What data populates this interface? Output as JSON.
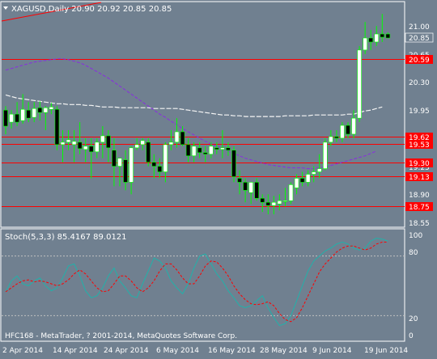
{
  "title": {
    "symbol_line": "XAGUSD,Daily  20.90 20.92 20.85 20.85"
  },
  "price_axis": {
    "ticks": [
      "21.00",
      "20.65",
      "20.30",
      "19.95",
      "19.25",
      "18.90",
      "18.55"
    ],
    "ylim": [
      18.45,
      21.2
    ]
  },
  "current_price": "20.85",
  "horizontal_levels": [
    {
      "label": "20.59",
      "value": 20.59
    },
    {
      "label": "19.62",
      "value": 19.62
    },
    {
      "label": "19.53",
      "value": 19.53
    },
    {
      "label": "19.30",
      "value": 19.3
    },
    {
      "label": "19.13",
      "value": 19.13
    },
    {
      "label": "18.75",
      "value": 18.75
    }
  ],
  "stoch": {
    "label": "Stoch(5,3,3) 85.4167 89.0121",
    "ticks": [
      "100",
      "80",
      "20",
      "0"
    ],
    "levels": [
      80,
      20
    ]
  },
  "date_axis": {
    "labels": [
      "2 Apr 2014",
      "14 Apr 2014",
      "24 Apr 2014",
      "6 May 2014",
      "16 May 2014",
      "28 May 2014",
      "9 Jun 2014",
      "19 Jun 2014"
    ]
  },
  "copyright": "HFC168 - MetaTrader, ? 2001-2014, MetaQuotes Software Corp.",
  "colors": {
    "background": "#708090",
    "bull_candle": "#ffffff",
    "bear_candle": "#000000",
    "wick": "#00ff00",
    "level_line": "#ff0000",
    "ma_slow": "#f5f5f5",
    "ma_fast": "#8a2be2",
    "stoch_main": "#20b2aa",
    "stoch_signal": "#ff0000"
  },
  "chart_data": {
    "type": "candlestick",
    "title": "XAGUSD,Daily",
    "candles": [
      {
        "o": 19.95,
        "h": 20.0,
        "l": 19.65,
        "c": 19.75
      },
      {
        "o": 19.8,
        "h": 19.95,
        "l": 19.72,
        "c": 19.9
      },
      {
        "o": 19.9,
        "h": 20.05,
        "l": 19.75,
        "c": 19.8
      },
      {
        "o": 19.82,
        "h": 20.15,
        "l": 19.78,
        "c": 19.96
      },
      {
        "o": 19.95,
        "h": 20.05,
        "l": 19.8,
        "c": 19.85
      },
      {
        "o": 19.86,
        "h": 20.05,
        "l": 19.8,
        "c": 19.97
      },
      {
        "o": 19.98,
        "h": 20.06,
        "l": 19.82,
        "c": 19.92
      },
      {
        "o": 19.92,
        "h": 20.0,
        "l": 19.7,
        "c": 19.98
      },
      {
        "o": 19.96,
        "h": 20.04,
        "l": 19.9,
        "c": 19.99
      },
      {
        "o": 19.96,
        "h": 20.0,
        "l": 19.45,
        "c": 19.52
      },
      {
        "o": 19.52,
        "h": 19.7,
        "l": 19.3,
        "c": 19.55
      },
      {
        "o": 19.55,
        "h": 19.7,
        "l": 19.45,
        "c": 19.58
      },
      {
        "o": 19.52,
        "h": 19.7,
        "l": 19.3,
        "c": 19.56
      },
      {
        "o": 19.55,
        "h": 19.8,
        "l": 19.4,
        "c": 19.47
      },
      {
        "o": 19.46,
        "h": 19.6,
        "l": 19.3,
        "c": 19.5
      },
      {
        "o": 19.5,
        "h": 19.6,
        "l": 19.1,
        "c": 19.43
      },
      {
        "o": 19.43,
        "h": 19.6,
        "l": 19.35,
        "c": 19.55
      },
      {
        "o": 19.55,
        "h": 19.75,
        "l": 19.35,
        "c": 19.63
      },
      {
        "o": 19.63,
        "h": 19.7,
        "l": 19.3,
        "c": 19.48
      },
      {
        "o": 19.45,
        "h": 19.6,
        "l": 19.0,
        "c": 19.25
      },
      {
        "o": 19.25,
        "h": 19.35,
        "l": 19.0,
        "c": 19.35
      },
      {
        "o": 19.33,
        "h": 19.45,
        "l": 18.95,
        "c": 19.05
      },
      {
        "o": 19.05,
        "h": 19.5,
        "l": 18.9,
        "c": 19.48
      },
      {
        "o": 19.48,
        "h": 19.6,
        "l": 19.45,
        "c": 19.52
      },
      {
        "o": 19.52,
        "h": 19.6,
        "l": 19.45,
        "c": 19.57
      },
      {
        "o": 19.55,
        "h": 19.6,
        "l": 19.25,
        "c": 19.3
      },
      {
        "o": 19.3,
        "h": 19.4,
        "l": 19.1,
        "c": 19.25
      },
      {
        "o": 19.25,
        "h": 19.35,
        "l": 19.1,
        "c": 19.18
      },
      {
        "o": 19.18,
        "h": 19.55,
        "l": 19.05,
        "c": 19.52
      },
      {
        "o": 19.52,
        "h": 19.7,
        "l": 19.45,
        "c": 19.55
      },
      {
        "o": 19.55,
        "h": 19.85,
        "l": 19.48,
        "c": 19.68
      },
      {
        "o": 19.68,
        "h": 19.75,
        "l": 19.5,
        "c": 19.52
      },
      {
        "o": 19.52,
        "h": 19.6,
        "l": 19.3,
        "c": 19.38
      },
      {
        "o": 19.38,
        "h": 19.55,
        "l": 19.3,
        "c": 19.5
      },
      {
        "o": 19.48,
        "h": 19.55,
        "l": 19.35,
        "c": 19.42
      },
      {
        "o": 19.42,
        "h": 19.5,
        "l": 19.3,
        "c": 19.4
      },
      {
        "o": 19.4,
        "h": 19.55,
        "l": 19.35,
        "c": 19.5
      },
      {
        "o": 19.48,
        "h": 19.55,
        "l": 19.4,
        "c": 19.46
      },
      {
        "o": 19.46,
        "h": 19.7,
        "l": 19.35,
        "c": 19.48
      },
      {
        "o": 19.48,
        "h": 19.55,
        "l": 19.38,
        "c": 19.45
      },
      {
        "o": 19.45,
        "h": 19.5,
        "l": 19.05,
        "c": 19.12
      },
      {
        "o": 19.1,
        "h": 19.2,
        "l": 18.9,
        "c": 19.05
      },
      {
        "o": 19.05,
        "h": 19.1,
        "l": 18.8,
        "c": 18.95
      },
      {
        "o": 18.92,
        "h": 19.05,
        "l": 18.78,
        "c": 19.05
      },
      {
        "o": 19.05,
        "h": 19.1,
        "l": 18.82,
        "c": 18.85
      },
      {
        "o": 18.85,
        "h": 18.9,
        "l": 18.68,
        "c": 18.8
      },
      {
        "o": 18.8,
        "h": 18.9,
        "l": 18.65,
        "c": 18.76
      },
      {
        "o": 18.76,
        "h": 18.88,
        "l": 18.65,
        "c": 18.8
      },
      {
        "o": 18.78,
        "h": 18.9,
        "l": 18.7,
        "c": 18.82
      },
      {
        "o": 18.82,
        "h": 18.98,
        "l": 18.75,
        "c": 18.82
      },
      {
        "o": 18.82,
        "h": 19.05,
        "l": 18.78,
        "c": 19.02
      },
      {
        "o": 18.98,
        "h": 19.15,
        "l": 18.9,
        "c": 19.1
      },
      {
        "o": 19.1,
        "h": 19.18,
        "l": 19.0,
        "c": 19.05
      },
      {
        "o": 19.05,
        "h": 19.2,
        "l": 19.0,
        "c": 19.15
      },
      {
        "o": 19.15,
        "h": 19.25,
        "l": 19.05,
        "c": 19.18
      },
      {
        "o": 19.18,
        "h": 19.4,
        "l": 19.1,
        "c": 19.22
      },
      {
        "o": 19.22,
        "h": 19.6,
        "l": 19.2,
        "c": 19.55
      },
      {
        "o": 19.55,
        "h": 19.7,
        "l": 19.5,
        "c": 19.62
      },
      {
        "o": 19.62,
        "h": 19.7,
        "l": 19.55,
        "c": 19.6
      },
      {
        "o": 19.6,
        "h": 19.8,
        "l": 19.55,
        "c": 19.76
      },
      {
        "o": 19.76,
        "h": 19.8,
        "l": 19.6,
        "c": 19.65
      },
      {
        "o": 19.65,
        "h": 19.95,
        "l": 19.6,
        "c": 19.85
      },
      {
        "o": 19.85,
        "h": 20.75,
        "l": 19.8,
        "c": 20.7
      },
      {
        "o": 20.7,
        "h": 21.05,
        "l": 20.65,
        "c": 20.85
      },
      {
        "o": 20.85,
        "h": 20.95,
        "l": 20.7,
        "c": 20.8
      },
      {
        "o": 20.8,
        "h": 21.0,
        "l": 20.75,
        "c": 20.9
      },
      {
        "o": 20.9,
        "h": 21.15,
        "l": 20.8,
        "c": 20.86
      },
      {
        "o": 20.9,
        "h": 20.92,
        "l": 20.85,
        "c": 20.85
      }
    ],
    "ma_slow": [
      20.14,
      20.12,
      20.1,
      20.09,
      20.08,
      20.07,
      20.06,
      20.05,
      20.04,
      20.03,
      20.03,
      20.02,
      20.02,
      20.02,
      20.01,
      20.01,
      20.0,
      19.99,
      19.99,
      19.99,
      19.98,
      19.98,
      19.98,
      19.98,
      19.98,
      19.98,
      19.97,
      19.97,
      19.97,
      19.97,
      19.97,
      19.96,
      19.95,
      19.94,
      19.93,
      19.92,
      19.91,
      19.9,
      19.89,
      19.89,
      19.88,
      19.88,
      19.87,
      19.87,
      19.87,
      19.87,
      19.87,
      19.87,
      19.87,
      19.88,
      19.88,
      19.88,
      19.88,
      19.88,
      19.89,
      19.89,
      19.89,
      19.89,
      19.89,
      19.89,
      19.9,
      19.9,
      19.92,
      19.94,
      19.95,
      19.97,
      19.99
    ],
    "ma_fast": [
      20.45,
      20.47,
      20.49,
      20.51,
      20.53,
      20.55,
      20.56,
      20.57,
      20.58,
      20.59,
      20.59,
      20.58,
      20.56,
      20.54,
      20.51,
      20.47,
      20.43,
      20.39,
      20.35,
      20.3,
      20.25,
      20.2,
      20.15,
      20.1,
      20.05,
      20.0,
      19.95,
      19.9,
      19.86,
      19.81,
      19.77,
      19.72,
      19.68,
      19.64,
      19.6,
      19.56,
      19.53,
      19.5,
      19.47,
      19.44,
      19.41,
      19.38,
      19.35,
      19.33,
      19.31,
      19.29,
      19.27,
      19.26,
      19.25,
      19.24,
      19.23,
      19.23,
      19.23,
      19.22,
      19.22,
      19.23,
      19.24,
      19.26,
      19.28,
      19.3,
      19.32,
      19.34,
      19.36,
      19.38,
      19.41,
      19.44
    ],
    "stoch_main": [
      44,
      55,
      60,
      52,
      50,
      55,
      58,
      50,
      45,
      48,
      58,
      70,
      72,
      60,
      45,
      38,
      40,
      48,
      60,
      68,
      55,
      48,
      40,
      38,
      52,
      65,
      78,
      75,
      68,
      55,
      48,
      42,
      52,
      68,
      80,
      82,
      72,
      62,
      55,
      45,
      38,
      30,
      28,
      30,
      35,
      40,
      28,
      18,
      10,
      12,
      20,
      35,
      50,
      65,
      75,
      80,
      85,
      88,
      92,
      94,
      92,
      88,
      86,
      88,
      95,
      98,
      97,
      95
    ],
    "stoch_signal": [
      44,
      48,
      52,
      55,
      56,
      54,
      55,
      54,
      52,
      50,
      52,
      56,
      62,
      66,
      62,
      55,
      48,
      44,
      45,
      52,
      60,
      60,
      55,
      48,
      44,
      48,
      55,
      65,
      72,
      72,
      66,
      58,
      52,
      52,
      60,
      70,
      75,
      74,
      68,
      60,
      50,
      42,
      36,
      32,
      31,
      32,
      34,
      30,
      22,
      16,
      14,
      18,
      28,
      40,
      52,
      64,
      72,
      78,
      84,
      88,
      90,
      90,
      88,
      86,
      88,
      92,
      94,
      94
    ]
  }
}
